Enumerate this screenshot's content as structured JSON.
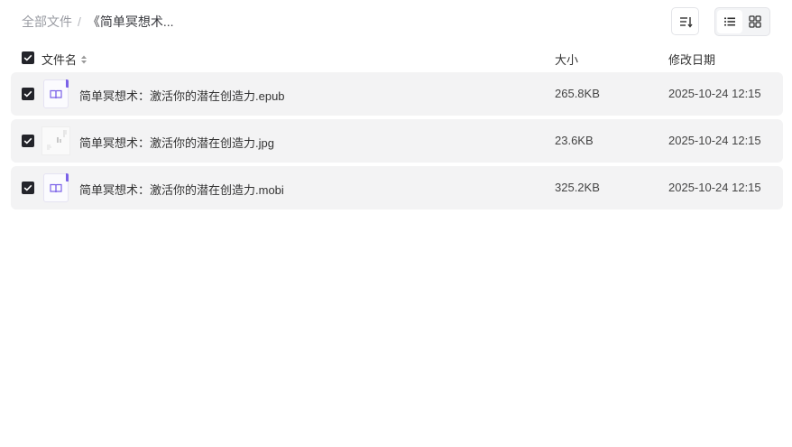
{
  "breadcrumb": {
    "root": "全部文件",
    "separator": "/",
    "current": "《简单冥想术..."
  },
  "toolbar": {
    "sort_icon": "sort-icon",
    "list_view_icon": "list-view-icon",
    "grid_view_icon": "grid-view-icon",
    "active_view": "list"
  },
  "list_header": {
    "name": "文件名",
    "size": "大小",
    "date": "修改日期",
    "all_selected": true
  },
  "files": [
    {
      "name": "简单冥想术：激活你的潜在创造力.epub",
      "size": "265.8KB",
      "date": "2025-10-24 12:15",
      "type": "ebook",
      "selected": true
    },
    {
      "name": "简单冥想术：激活你的潜在创造力.jpg",
      "size": "23.6KB",
      "date": "2025-10-24 12:15",
      "type": "image",
      "selected": true
    },
    {
      "name": "简单冥想术：激活你的潜在创造力.mobi",
      "size": "325.2KB",
      "date": "2025-10-24 12:15",
      "type": "ebook",
      "selected": true
    }
  ],
  "colors": {
    "row_background": "#f3f3f4",
    "checkbox": "#23242a",
    "ebook_accent": "#7b62e8"
  }
}
